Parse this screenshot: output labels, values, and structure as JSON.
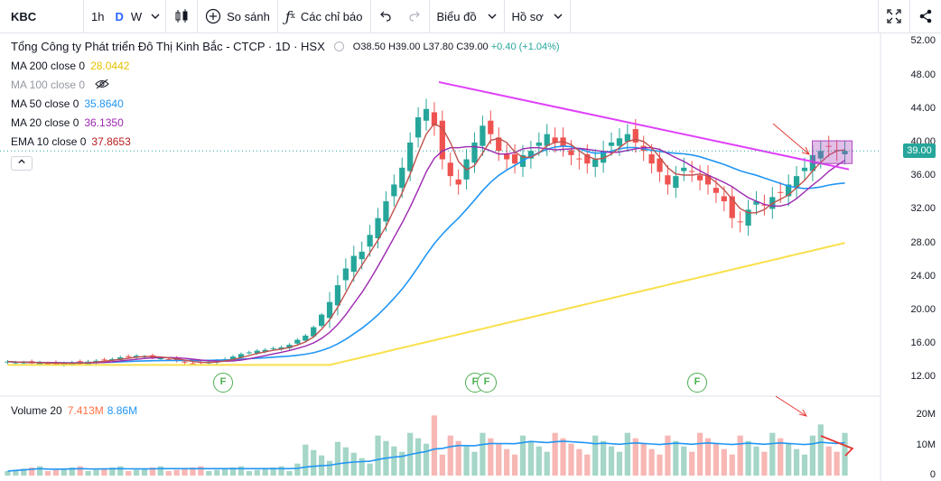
{
  "toolbar": {
    "symbol": "KBC",
    "interval_1h": "1h",
    "interval_d": "D",
    "interval_w": "W",
    "compare_label": "So sánh",
    "indicators_label": "Các chỉ báo",
    "chart_type_label": "Biểu đồ",
    "profile_label": "Hồ sơ"
  },
  "header": {
    "title": "Tổng Công ty Phát triển Đô Thị Kinh Bắc - CTCP · 1D · HSX",
    "open": "O38.50",
    "high": "H39.00",
    "low": "L37.80",
    "close": "C39.00",
    "change": "+0.40 (+1.04%)"
  },
  "indicators": [
    {
      "label": "MA 200 close 0",
      "value": "28.0442",
      "color": "#f9e04b"
    },
    {
      "label": "MA 100 close 0",
      "value": "",
      "color": "#b2b5be",
      "hidden": true
    },
    {
      "label": "MA 50 close 0",
      "value": "35.8640",
      "color": "#2196f3"
    },
    {
      "label": "MA 20 close 0",
      "value": "36.1350",
      "color": "#9c27b0"
    },
    {
      "label": "EMA 10 close 0",
      "value": "37.8653",
      "color": "#b71c1c"
    }
  ],
  "colors": {
    "up": "#26a69a",
    "down": "#ef5350",
    "trendline": "#e040fb",
    "ma200": "#f9e04b",
    "ma50": "#2196f3",
    "ma20": "#9c27b0",
    "ema10": "#c0504d",
    "vol_ma": "#2196f3"
  },
  "price_axis": [
    "52.00",
    "48.00",
    "44.00",
    "40.00",
    "36.00",
    "32.00",
    "28.00",
    "24.00",
    "20.00",
    "16.00",
    "12.00"
  ],
  "last_price": "39.00",
  "volume": {
    "label": "Volume 20",
    "value": "7.413M",
    "ma_value": "8.86M",
    "axis": [
      "20M",
      "10M",
      "0"
    ]
  },
  "events": [
    "F",
    "F",
    "F",
    "F"
  ],
  "chart_data": {
    "type": "candlestick",
    "price_range": [
      10,
      53
    ],
    "closes": [
      13.9,
      13.8,
      13.8,
      13.7,
      13.8,
      13.7,
      13.6,
      13.7,
      13.8,
      13.7,
      13.9,
      14,
      14.1,
      14.2,
      14.4,
      14.5,
      14.6,
      14.5,
      14.4,
      14.3,
      14.2,
      14,
      13.8,
      13.7,
      13.8,
      13.9,
      14,
      14.2,
      14.5,
      14.8,
      15,
      15.2,
      15.3,
      15.5,
      15.6,
      15.9,
      16.5,
      17,
      18,
      19.5,
      21,
      23,
      25,
      26.5,
      27,
      29,
      31,
      33,
      35,
      37,
      40,
      43,
      44,
      42,
      38,
      36,
      35,
      38,
      40,
      42,
      41,
      39,
      38,
      37.5,
      38.5,
      39,
      40,
      41,
      40,
      39.5,
      38.5,
      38,
      37.5,
      38,
      39,
      40,
      40.5,
      41,
      40,
      39,
      37.5,
      36.5,
      35,
      36,
      37,
      36.5,
      35.5,
      35,
      34,
      33,
      31,
      30.5,
      32,
      33,
      32.5,
      33.5,
      34,
      35,
      36,
      37,
      38.5,
      39,
      39.5,
      39,
      39
    ],
    "ma200_start": 13.5,
    "ma200_end": 28.0442,
    "ma50_end": 35.864,
    "ma20_end": 36.135,
    "ema10_end": 37.8653,
    "trendline": {
      "start_price": 47.2,
      "end_price": 36.8
    },
    "volume_range_millions": [
      0,
      24
    ],
    "volume_ma_end_millions": 8.86,
    "last_volume_millions": 7.413
  }
}
